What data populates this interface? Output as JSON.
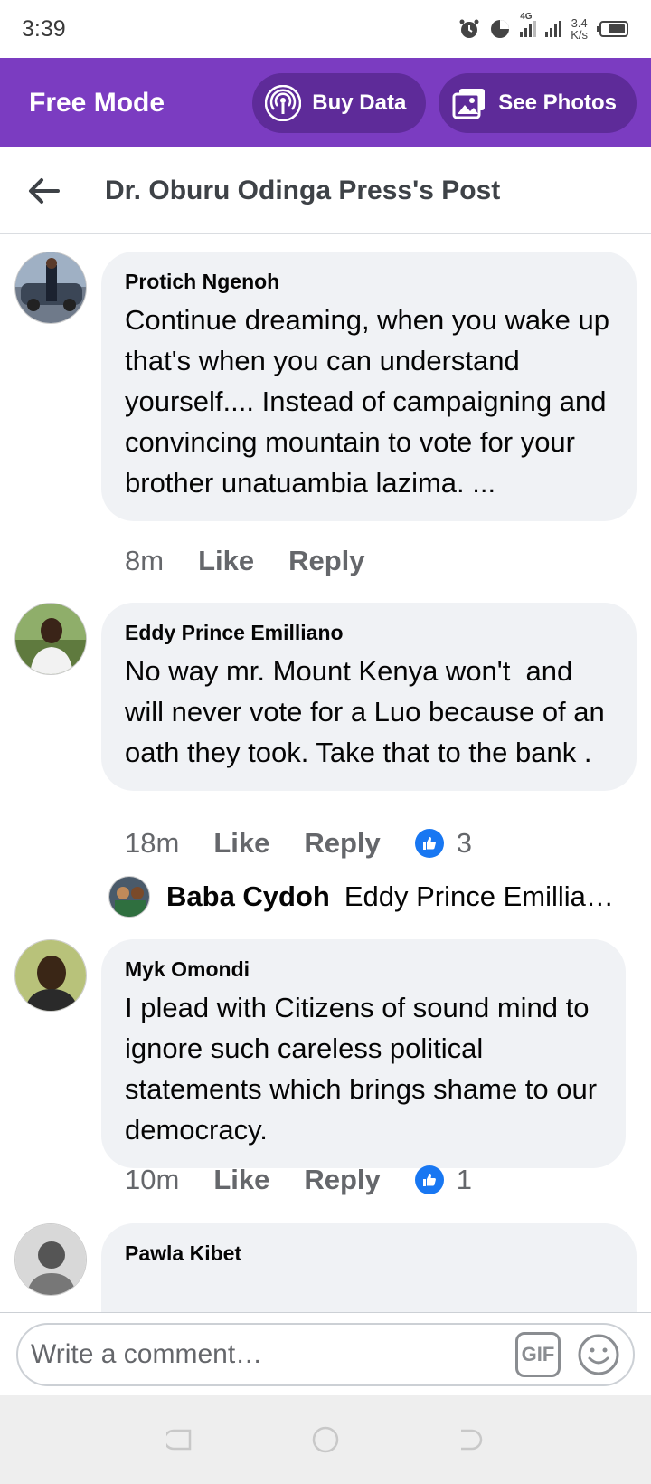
{
  "status_bar": {
    "time": "3:39",
    "network": "4G",
    "speed_value": "3.4",
    "speed_unit": "K/s"
  },
  "free_mode": {
    "title": "Free Mode",
    "buy_data_label": "Buy Data",
    "see_photos_label": "See Photos"
  },
  "header": {
    "title": "Dr. Oburu Odinga Press's Post"
  },
  "comments": [
    {
      "author": "Protich Ngenoh",
      "text": "Continue dreaming, when you wake up that's when you can understand yourself.... Instead of campaigning and convincing mountain to vote for your brother unatuambia lazima. ...",
      "time": "8m",
      "like_label": "Like",
      "reply_label": "Reply"
    },
    {
      "author": "Eddy Prince Emilliano",
      "text": "No way mr. Mount Kenya won't  and will never vote for a Luo because of an oath they took. Take that to the bank .",
      "time": "18m",
      "like_label": "Like",
      "reply_label": "Reply",
      "reaction_count": "3",
      "reply_preview": {
        "author": "Baba Cydoh",
        "text": "Eddy Prince Emilliano"
      }
    },
    {
      "author": "Myk Omondi",
      "text": "I plead with Citizens of sound mind to ignore such careless political statements which brings shame to our democracy.",
      "time": "10m",
      "like_label": "Like",
      "reply_label": "Reply",
      "reaction_count": "1"
    },
    {
      "author": "Pawla Kibet"
    }
  ],
  "composer": {
    "placeholder": "Write a comment…",
    "gif_label": "GIF"
  },
  "colors": {
    "brand_purple": "#7b3cc1",
    "pill_purple": "#5e2b99",
    "like_blue": "#1877f2",
    "bubble_gray": "#f0f2f5"
  }
}
